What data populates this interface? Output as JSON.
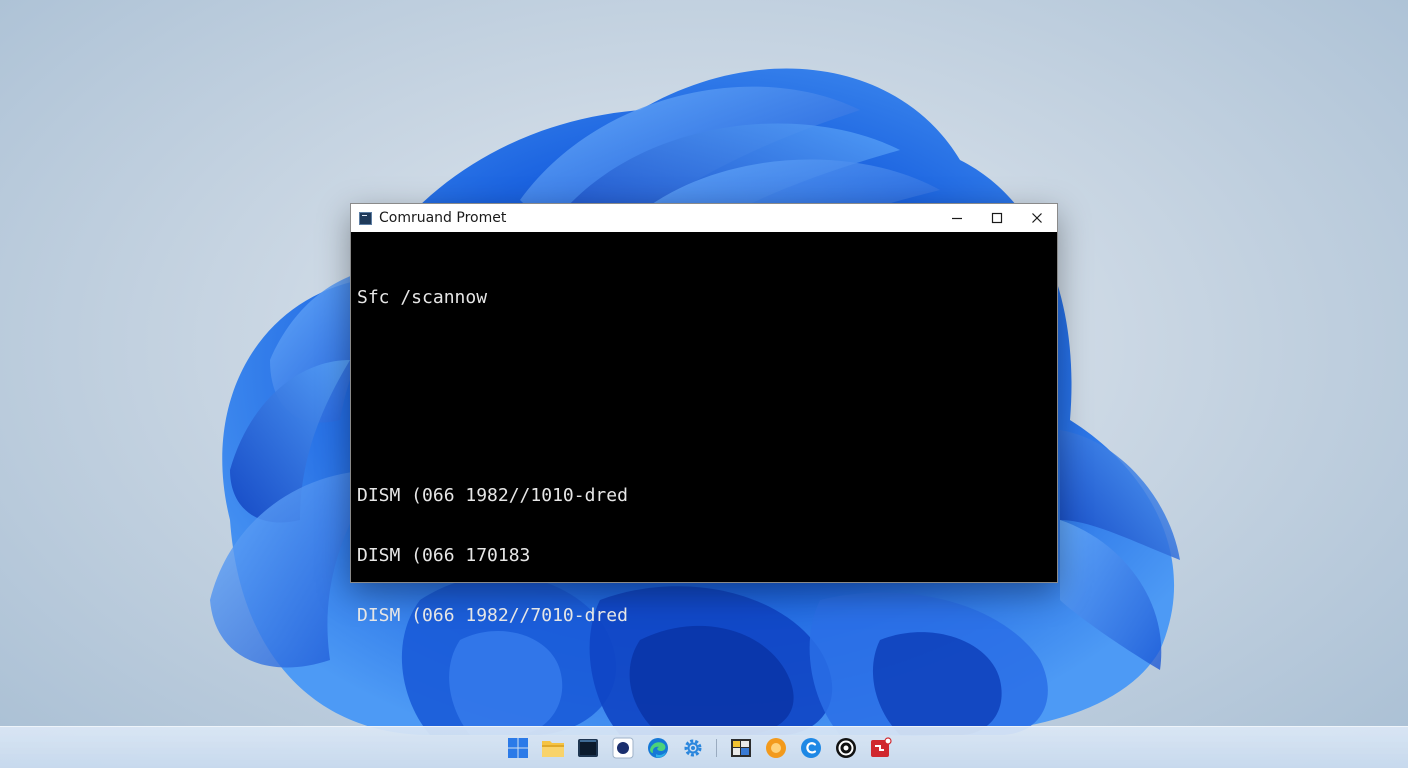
{
  "window": {
    "title": "Comruand Promet",
    "controls": {
      "minimize": "minimize-icon",
      "maximize": "maximize-icon",
      "close": "close-icon"
    }
  },
  "console": {
    "command": "Sfc /scannow",
    "output": [
      "DISM (066 1982//1010-dred",
      "DISM (066 170183",
      "DISM (066 1982//7010-dred"
    ]
  },
  "taskbar": {
    "icons": [
      "start-icon",
      "file-explorer-icon",
      "terminal-icon",
      "app-icon",
      "edge-icon",
      "settings-icon",
      "photos-icon",
      "orange-app-icon",
      "c-app-icon",
      "target-app-icon",
      "red-app-icon"
    ]
  },
  "colors": {
    "accent": "#1e6fe6",
    "console_bg": "#000000",
    "console_text": "#e6e6e6",
    "titlebar_bg": "#ffffff"
  }
}
